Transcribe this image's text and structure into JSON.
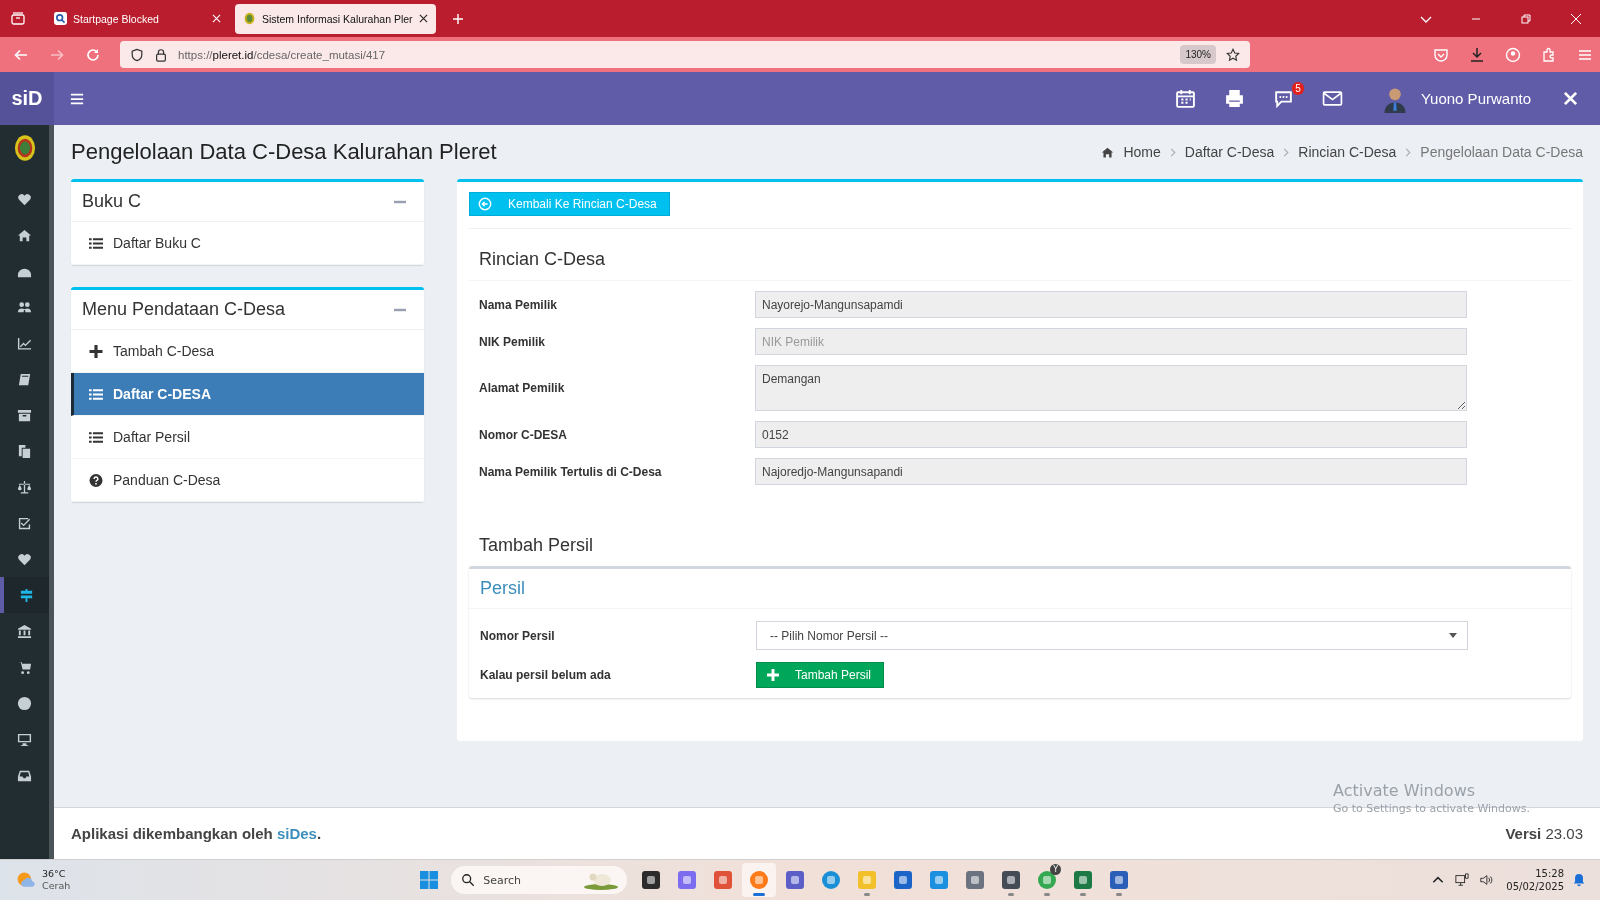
{
  "browser": {
    "tabs": [
      {
        "title": "Startpage Blocked",
        "selected": false
      },
      {
        "title": "Sistem Informasi Kalurahan Pler",
        "selected": true
      }
    ],
    "url": {
      "scheme": "https://",
      "host": "pleret.id",
      "path": "/cdesa/create_mutasi/417"
    },
    "zoom": "130%"
  },
  "header": {
    "brand": "siD",
    "notification_count": "5",
    "user_name": "Yuono Purwanto"
  },
  "nav_items": [
    {
      "selected": false
    },
    {
      "selected": false
    },
    {
      "selected": false
    },
    {
      "selected": false
    },
    {
      "selected": false
    },
    {
      "selected": false
    },
    {
      "selected": false
    },
    {
      "selected": false
    },
    {
      "selected": false
    },
    {
      "selected": false
    },
    {
      "selected": false
    },
    {
      "selected": true
    },
    {
      "selected": false
    },
    {
      "selected": false
    },
    {
      "selected": false
    },
    {
      "selected": false
    },
    {
      "selected": false
    }
  ],
  "page_title": "Pengelolaan Data C-Desa Kalurahan Pleret",
  "breadcrumb": [
    "Home",
    "Daftar C-Desa",
    "Rincian C-Desa",
    "Pengelolaan Data C-Desa"
  ],
  "panels": [
    {
      "title": "Buku C",
      "items": [
        {
          "kind": "list",
          "label": "Daftar Buku C",
          "selected": false
        }
      ]
    },
    {
      "title": "Menu Pendataan C-Desa",
      "items": [
        {
          "kind": "add",
          "label": "Tambah C-Desa",
          "selected": false
        },
        {
          "kind": "list",
          "label": "Daftar C-DESA",
          "selected": true
        },
        {
          "kind": "list",
          "label": "Daftar Persil",
          "selected": false
        },
        {
          "kind": "help",
          "label": "Panduan C-Desa",
          "selected": false
        }
      ]
    }
  ],
  "back_button": "Kembali Ke Rincian C-Desa",
  "details": {
    "title": "Rincian C-Desa",
    "fields": [
      {
        "kind": "text",
        "label": "Nama Pemilik",
        "value": "Nayorejo-Mangunsapamdi"
      },
      {
        "kind": "text",
        "label": "NIK Pemilik",
        "placeholder": "NIK Pemilik"
      },
      {
        "kind": "textarea",
        "label": "Alamat Pemilik",
        "value": "Demangan"
      },
      {
        "kind": "text",
        "label": "Nomor C-DESA",
        "value": "0152"
      },
      {
        "kind": "text",
        "label": "Nama Pemilik Tertulis di C-Desa",
        "value": "Najoredjo-Mangunsapandi"
      }
    ]
  },
  "persil": {
    "section_title": "Tambah Persil",
    "box_title": "Persil",
    "select_label": "Nomor Persil",
    "select_value": "-- Pilih Nomor Persil --",
    "add_label": "Kalau persil belum ada",
    "add_button": "Tambah Persil"
  },
  "footer": {
    "credit_prefix": "Aplikasi dikembangkan oleh",
    "credit_link": "siDes",
    "credit_suffix": ".",
    "version": "**Versi** 23.03"
  },
  "watermark": {
    "title": "Activate Windows",
    "hint": "Go to Settings to activate Windows."
  },
  "taskbar": {
    "temperature": "36°C",
    "weather": "Cerah",
    "search_placeholder": "Search",
    "apps": [
      {
        "running": false,
        "selected": false
      },
      {
        "running": false,
        "selected": false
      },
      {
        "running": false,
        "selected": false
      },
      {
        "running": true,
        "selected": true
      },
      {
        "running": false,
        "selected": false
      },
      {
        "running": false,
        "selected": false
      },
      {
        "running": true,
        "selected": false
      },
      {
        "running": false,
        "selected": false
      },
      {
        "running": false,
        "selected": false
      },
      {
        "running": false,
        "selected": false
      },
      {
        "running": true,
        "selected": false
      },
      {
        "running": true,
        "selected": false,
        "badge": "Y"
      },
      {
        "running": true,
        "selected": false
      },
      {
        "running": true,
        "selected": false
      }
    ],
    "time": "15:28",
    "date": "05/02/2025"
  }
}
